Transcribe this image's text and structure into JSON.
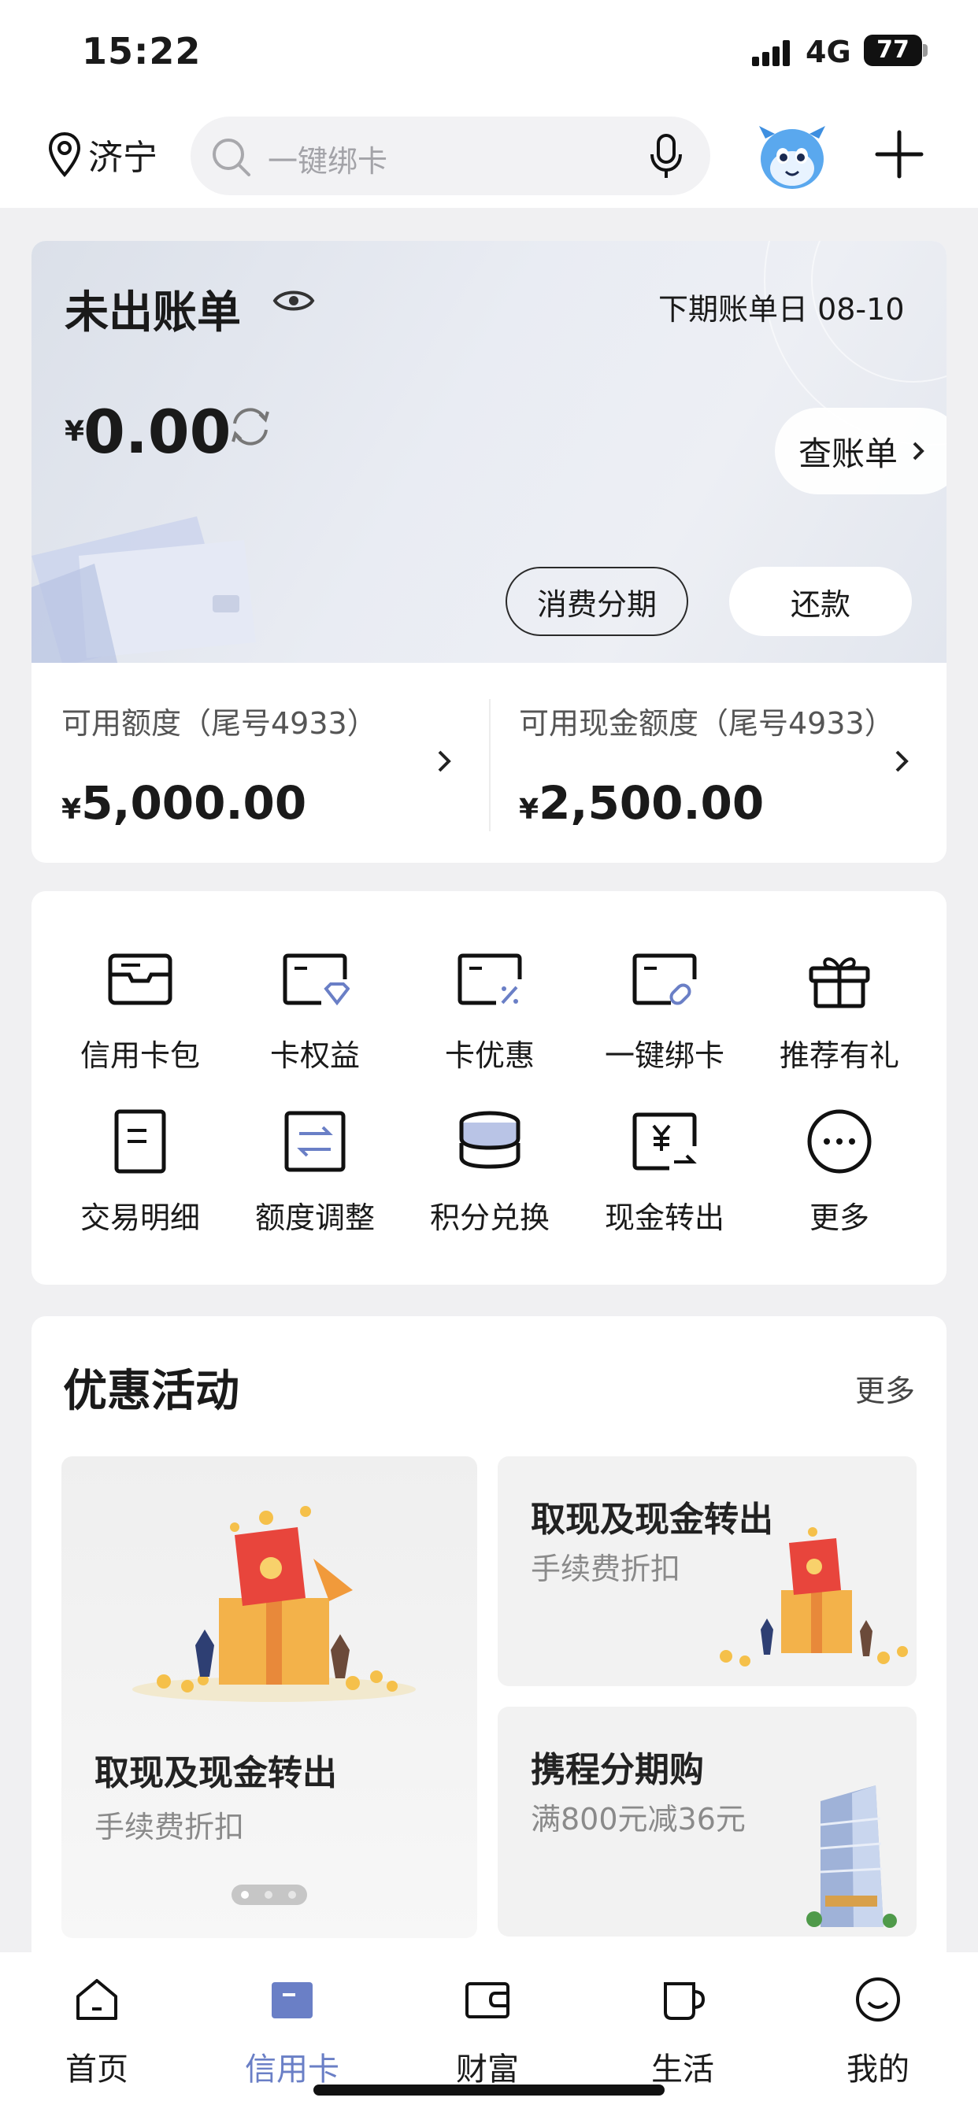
{
  "status_bar": {
    "time": "15:22",
    "network": "4G",
    "battery": "77"
  },
  "header": {
    "location": "济宁",
    "search_placeholder": "一键绑卡"
  },
  "bill": {
    "title": "未出账单",
    "next_bill_date": "下期账单日 08-10",
    "currency": "¥",
    "amount": "0.00",
    "view_bill_label": "查账单",
    "installment_label": "消费分期",
    "repay_label": "还款"
  },
  "limits": [
    {
      "label": "可用额度（尾号4933）",
      "currency": "¥",
      "value": "5,000.00"
    },
    {
      "label": "可用现金额度（尾号4933）",
      "currency": "¥",
      "value": "2,500.00"
    }
  ],
  "menu": [
    {
      "label": "信用卡包",
      "icon": "card-wallet-icon"
    },
    {
      "label": "卡权益",
      "icon": "card-benefits-icon"
    },
    {
      "label": "卡优惠",
      "icon": "card-discount-icon"
    },
    {
      "label": "一键绑卡",
      "icon": "card-link-icon"
    },
    {
      "label": "推荐有礼",
      "icon": "gift-icon"
    },
    {
      "label": "交易明细",
      "icon": "document-icon"
    },
    {
      "label": "额度调整",
      "icon": "transfer-icon"
    },
    {
      "label": "积分兑换",
      "icon": "coins-stack-icon"
    },
    {
      "label": "现金转出",
      "icon": "cash-out-icon"
    },
    {
      "label": "更多",
      "icon": "more-icon"
    }
  ],
  "promo": {
    "title": "优惠活动",
    "more": "更多",
    "featured": {
      "title": "取现及现金转出",
      "subtitle": "手续费折扣"
    },
    "items": [
      {
        "title": "取现及现金转出",
        "subtitle": "手续费折扣"
      },
      {
        "title": "携程分期购",
        "subtitle": "满800元减36元"
      }
    ]
  },
  "tabs": [
    {
      "label": "首页",
      "icon": "home-icon",
      "active": false
    },
    {
      "label": "信用卡",
      "icon": "credit-card-icon",
      "active": true
    },
    {
      "label": "财富",
      "icon": "wallet-icon",
      "active": false
    },
    {
      "label": "生活",
      "icon": "cup-icon",
      "active": false
    },
    {
      "label": "我的",
      "icon": "smile-icon",
      "active": false
    }
  ],
  "colors": {
    "accent": "#6a7fc6",
    "background": "#f0f0f2",
    "card": "#ffffff"
  }
}
